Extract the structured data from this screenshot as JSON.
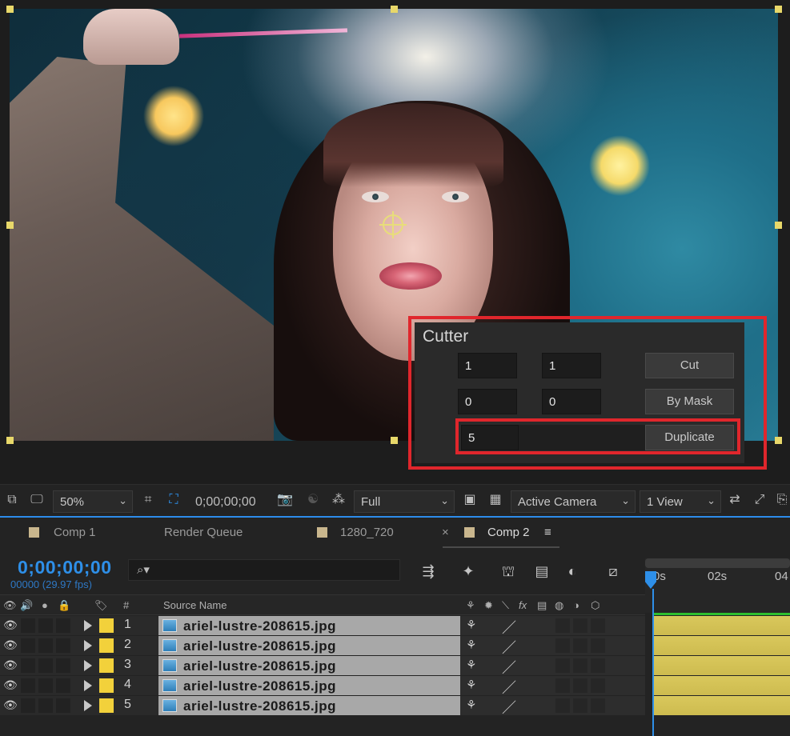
{
  "cutter": {
    "title": "Cutter",
    "row1": {
      "a": "1",
      "b": "1",
      "button": "Cut"
    },
    "row2": {
      "a": "0",
      "b": "0",
      "button": "By Mask"
    },
    "row3": {
      "a": "5",
      "button": "Duplicate"
    }
  },
  "viewer_toolbar": {
    "zoom": "50%",
    "timecode": "0;00;00;00",
    "resolution": "Full",
    "camera": "Active Camera",
    "views": "1 View"
  },
  "tabs": [
    {
      "label": "Comp 1"
    },
    {
      "label": "Render Queue"
    },
    {
      "label": "1280_720"
    },
    {
      "label": "Comp 2",
      "close": "×",
      "menu": "≡"
    }
  ],
  "timeline": {
    "timecode": "0;00;00;00",
    "frames": "00000 (29.97 fps)",
    "search_glyph": "⌕▾",
    "ruler_labels": [
      "0s",
      "02s",
      "04"
    ],
    "source_name_header": "Source Name",
    "hash_header": "#"
  },
  "layers": [
    {
      "num": "1",
      "name": "ariel-lustre-208615.jpg"
    },
    {
      "num": "2",
      "name": "ariel-lustre-208615.jpg"
    },
    {
      "num": "3",
      "name": "ariel-lustre-208615.jpg"
    },
    {
      "num": "4",
      "name": "ariel-lustre-208615.jpg"
    },
    {
      "num": "5",
      "name": "ariel-lustre-208615.jpg"
    }
  ],
  "colors": {
    "accent_blue": "#2e8fe8",
    "highlight_red": "#e0262c",
    "layer_label_yellow": "#f2d13b",
    "clip_bar_yellow": "#d9c85c"
  }
}
